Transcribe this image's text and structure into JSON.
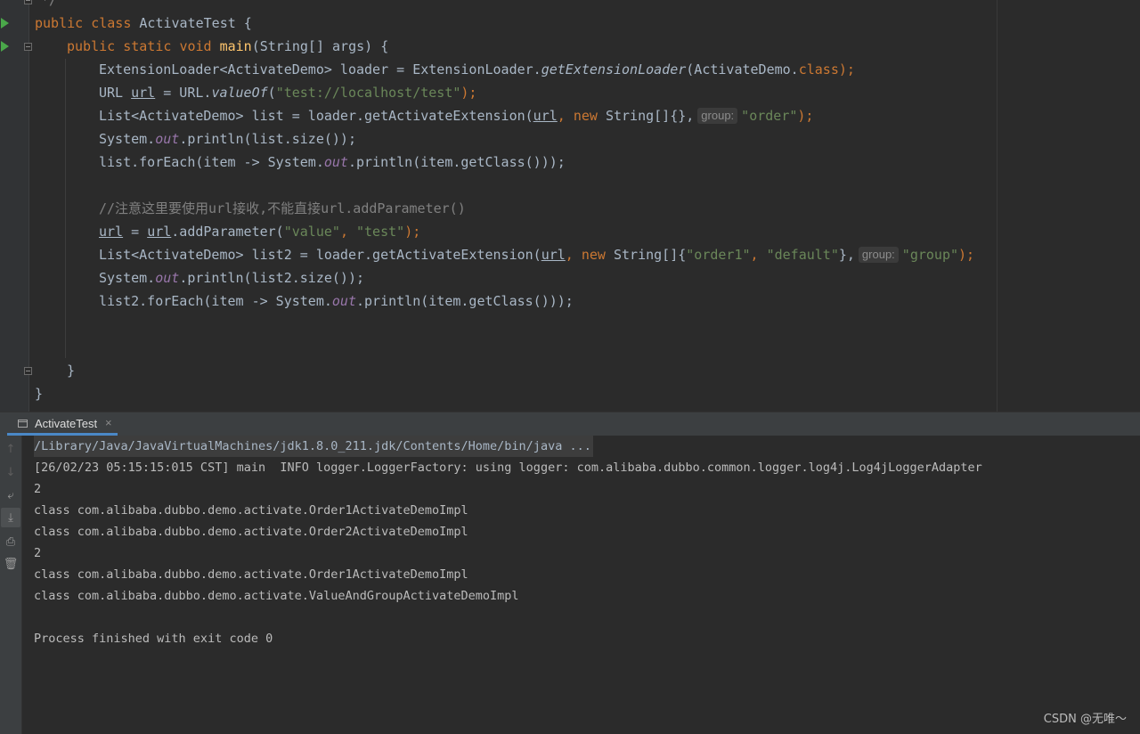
{
  "editor": {
    "lines": {
      "l0_comment": "*/",
      "l1_a": "public ",
      "l1_b": "class ",
      "l1_c": "ActivateTest {",
      "l2_a": "public ",
      "l2_b": "static ",
      "l2_c": "void ",
      "l2_d": "main",
      "l2_e": "(String[] args) {",
      "l3_a": "ExtensionLoader<ActivateDemo> loader = ExtensionLoader.",
      "l3_b": "getExtensionLoader",
      "l3_c": "(ActivateDemo.",
      "l3_d": "class",
      "l3_e": ");",
      "l4_a": "URL ",
      "l4_b": "url",
      "l4_c": " = URL.",
      "l4_d": "valueOf",
      "l4_e": "(",
      "l4_f": "\"test://localhost/test\"",
      "l4_g": ");",
      "l5_a": "List<ActivateDemo> list = loader.getActivateExtension(",
      "l5_b": "url",
      "l5_c": ", ",
      "l5_d": "new ",
      "l5_e": "String[]{},",
      "l5_hint": "group:",
      "l5_f": "\"order\"",
      "l5_g": ");",
      "l6_a": "System.",
      "l6_b": "out",
      "l6_c": ".println(list.size());",
      "l7_a": "list.forEach(item -> System.",
      "l7_b": "out",
      "l7_c": ".println(item.getClass()));",
      "l9_comment": "//注意这里要使用url接收,不能直接url.addParameter()",
      "l10_a": "url",
      "l10_b": " = ",
      "l10_c": "url",
      "l10_d": ".addParameter(",
      "l10_e": "\"value\"",
      "l10_f": ", ",
      "l10_g": "\"test\"",
      "l10_h": ");",
      "l11_a": "List<ActivateDemo> list2 = loader.getActivateExtension(",
      "l11_b": "url",
      "l11_c": ", ",
      "l11_d": "new ",
      "l11_e": "String[]{",
      "l11_f": "\"order1\"",
      "l11_g": ", ",
      "l11_h": "\"default\"",
      "l11_i": "},",
      "l11_hint": "group:",
      "l11_j": "\"group\"",
      "l11_k": ");",
      "l12_a": "System.",
      "l12_b": "out",
      "l12_c": ".println(list2.size());",
      "l13_a": "list2.forEach(item -> System.",
      "l13_b": "out",
      "l13_c": ".println(item.getClass()));",
      "l16": "}",
      "l17": "}"
    }
  },
  "run_panel": {
    "tab_label": "ActivateTest",
    "tab_close": "×",
    "toolbar_icons": [
      "arrow-up-icon",
      "arrow-down-icon",
      "soft-wrap-icon",
      "scroll-to-end-icon",
      "print-icon",
      "trash-icon"
    ],
    "output": [
      "/Library/Java/JavaVirtualMachines/jdk1.8.0_211.jdk/Contents/Home/bin/java ...",
      "[26/02/23 05:15:15:015 CST] main  INFO logger.LoggerFactory: using logger: com.alibaba.dubbo.common.logger.log4j.Log4jLoggerAdapter",
      "2",
      "class com.alibaba.dubbo.demo.activate.Order1ActivateDemoImpl",
      "class com.alibaba.dubbo.demo.activate.Order2ActivateDemoImpl",
      "2",
      "class com.alibaba.dubbo.demo.activate.Order1ActivateDemoImpl",
      "class com.alibaba.dubbo.demo.activate.ValueAndGroupActivateDemoImpl",
      "",
      "Process finished with exit code 0"
    ]
  },
  "watermark": "CSDN @无唯～",
  "colors": {
    "background": "#2b2b2b",
    "keyword": "#cc7832",
    "string": "#6a8759",
    "static_field": "#9876aa",
    "method_decl": "#ffc66d",
    "comment": "#808080",
    "run_gutter": "#4aa84a"
  }
}
